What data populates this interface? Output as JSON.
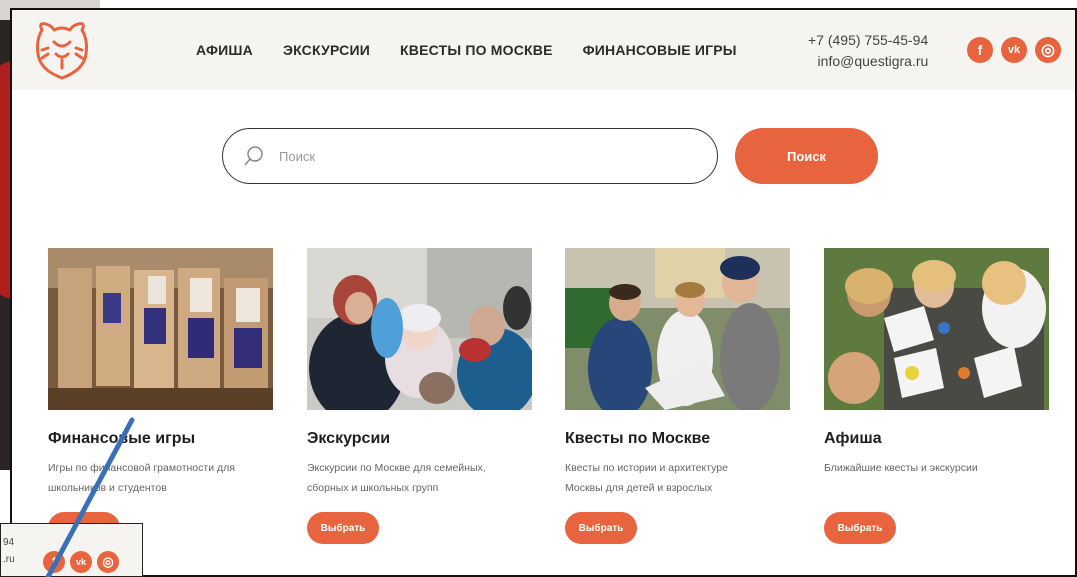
{
  "header": {
    "nav": [
      "АФИША",
      "ЭКСКУРСИИ",
      "КВЕСТЫ ПО МОСКВЕ",
      "ФИНАНСОВЫЕ ИГРЫ"
    ],
    "phone": "+7 (495) 755-45-94",
    "email": "info@questigra.ru",
    "social": [
      {
        "icon": "facebook-icon",
        "glyph": "f"
      },
      {
        "icon": "vk-icon",
        "glyph": "vk"
      },
      {
        "icon": "instagram-icon",
        "glyph": "◎"
      }
    ]
  },
  "search": {
    "placeholder": "Поиск",
    "button_label": "Поиск"
  },
  "cards": [
    {
      "title": "Финансовые игры",
      "desc1": "Игры по финансовой грамотности для",
      "desc2": "школьников и студентов",
      "button": "Выбрать"
    },
    {
      "title": "Экскурсии",
      "desc1": "Экскурсии по Москве для семейных,",
      "desc2": "сборных и школьных групп",
      "button": "Выбрать"
    },
    {
      "title": "Квесты по Москве",
      "desc1": "Квесты по истории и архитектуре",
      "desc2": "Москвы для детей и взрослых",
      "button": "Выбрать"
    },
    {
      "title": "Афиша",
      "desc1": "Ближайшие квесты и экскурсии",
      "desc2": "",
      "button": "Выбрать"
    }
  ],
  "inset": {
    "line1": "94",
    "line2": ".ru"
  },
  "colors": {
    "accent": "#e8643f",
    "header_bg": "#f6f4f1",
    "pointer_line": "#3b6fb6"
  }
}
